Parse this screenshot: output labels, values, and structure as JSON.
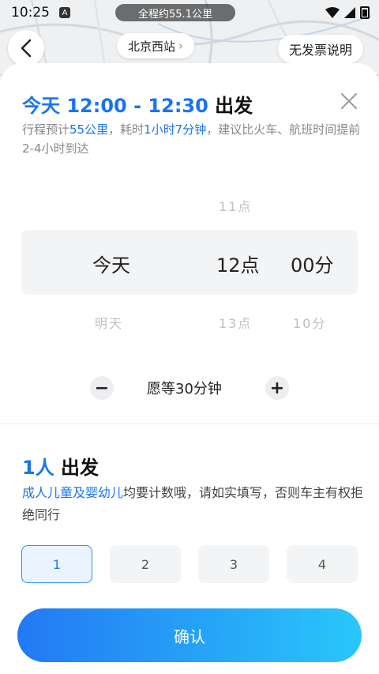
{
  "status_bar": {
    "time": "10:25",
    "app_badge": "A",
    "route_summary": "全程约55.1公里"
  },
  "top": {
    "station": "北京西站",
    "invoice_label": "无发票说明"
  },
  "departure": {
    "prefix": "今天 12:00 - 12:30",
    "suffix": " 出发",
    "info_p1": "行程预计",
    "info_distance": "55公里",
    "info_p2": "，耗时",
    "info_duration": "1小时7分钟",
    "info_p3": "，建议比火车、航班时间提前2-4小时到达"
  },
  "picker": {
    "above": {
      "hour": "11点"
    },
    "selected": {
      "day": "今天",
      "hour": "12点",
      "minute": "00分"
    },
    "below": {
      "day": "明天",
      "hour": "13点",
      "minute": "10分"
    }
  },
  "wait": {
    "minus": "−",
    "label": "愿等30分钟",
    "plus": "+"
  },
  "passengers": {
    "count": "1人",
    "suffix": " 出发",
    "info_highlight": "成人儿童及婴幼儿",
    "info_rest": "均要计数哦，请如实填写，否则车主有权拒绝同行",
    "options": [
      "1",
      "2",
      "3",
      "4"
    ],
    "selected_index": 0
  },
  "confirm_label": "确认",
  "colors": {
    "accent": "#1a74f0",
    "button_start": "#2379f3",
    "button_end": "#29c7fb"
  }
}
